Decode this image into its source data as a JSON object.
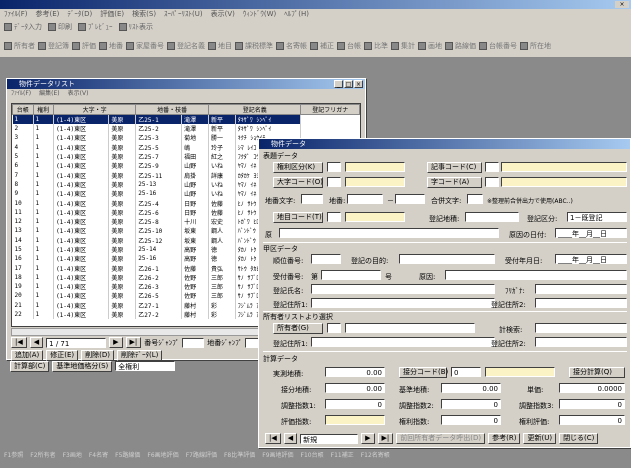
{
  "app": {
    "title": "",
    "menu": [
      "ﾌｧｲﾙ(F)",
      "参考(E)",
      "ﾃﾞｰﾀ(D)",
      "評価(E)",
      "検索(S)",
      "ｽｰﾊﾟｰﾘｽﾄ(U)",
      "表示(V)",
      "ｳｨﾝﾄﾞｳ(W)",
      "ﾍﾙﾌﾟ(H)"
    ],
    "toolbar1": [
      "ﾃﾞｰﾀ入力",
      "印刷",
      "ﾌﾟﾚﾋﾞｭｰ",
      "ﾘｽﾄ表示"
    ],
    "toolbar2": [
      "所有者",
      "登記簿",
      "評価",
      "地番",
      "家屋番号",
      "登記名義",
      "地目",
      "課税標準",
      "名寄帳",
      "補正",
      "台帳",
      "比準",
      "集計",
      "画地",
      "路線価",
      "台帳番号",
      "所在地"
    ],
    "statusbar": [
      "F1参照",
      "F2所有者",
      "F3画地",
      "F4名寄",
      "F5路線価",
      "F6画地評価",
      "F7路線評価",
      "F8比準評価",
      "F9画地評価",
      "F10台帳",
      "F11補正",
      "F12名寄帳"
    ]
  },
  "listwin": {
    "title": "物件データリスト",
    "menu": [
      "ﾌｧｲﾙ(F)",
      "編集(E)",
      "表示(V)"
    ],
    "columns": [
      "台帳",
      "権利",
      "大字・字",
      "地番・枝番",
      "登記名義",
      "登記フリガナ"
    ],
    "rows": [
      [
        "1",
        "1",
        "(1-4)東区",
        "美原",
        "乙25-1",
        "滝澤",
        "新平",
        "ﾀｷｻﾞﾜ ｼﾝﾍﾟｲ"
      ],
      [
        "2",
        "1",
        "(1-4)東区",
        "美原",
        "乙25-2",
        "滝澤",
        "新平",
        "ﾀｷｻﾞﾜ ｼﾝﾍﾟｲ"
      ],
      [
        "3",
        "1",
        "(1-4)東区",
        "美原",
        "乙25-3",
        "菊地",
        "勝一",
        "ｷｸﾁ ｼｮｳｲﾁ"
      ],
      [
        "4",
        "1",
        "(1-4)東区",
        "美原",
        "乙25-5",
        "嶋",
        "玲子",
        "ｼﾏ ﾚｲｺ"
      ],
      [
        "5",
        "1",
        "(1-4)東区",
        "美原",
        "乙25-7",
        "福田",
        "紅之",
        "ﾌｸﾀﾞ ｺｳﾉ"
      ],
      [
        "6",
        "1",
        "(1-4)東区",
        "美原",
        "乙25-9",
        "山野",
        "いね",
        "ﾔﾏﾉ ｲﾈ"
      ],
      [
        "7",
        "1",
        "(1-4)東区",
        "美原",
        "乙25-11",
        "肩掛",
        "詳康",
        "ｶﾀｶｹ ﾖｼﾔｽ"
      ],
      [
        "8",
        "1",
        "(1-4)東区",
        "美原",
        "25-13",
        "山野",
        "いね",
        "ﾔﾏﾉ ｲﾈ"
      ],
      [
        "9",
        "1",
        "(1-4)東区",
        "美原",
        "25-16",
        "山野",
        "いね",
        "ﾔﾏﾉ ｲﾈ"
      ],
      [
        "10",
        "1",
        "(1-4)東区",
        "美原",
        "乙25-4",
        "日野",
        "佐藤",
        "ﾋﾉ ｻﾄｳ"
      ],
      [
        "11",
        "1",
        "(1-4)東区",
        "美原",
        "乙25-6",
        "日野",
        "佐藤",
        "ﾋﾉ ｻﾄｳ"
      ],
      [
        "12",
        "1",
        "(1-4)東区",
        "美原",
        "乙25-8",
        "十川",
        "宏史",
        "ﾄｶﾞﾜ ﾋﾛｼ"
      ],
      [
        "13",
        "1",
        "(1-4)東区",
        "美原",
        "乙25-10",
        "坂東",
        "鋼人",
        "ﾊﾞﾝﾄﾞｳ ｺｳｼﾞﾝ"
      ],
      [
        "14",
        "1",
        "(1-4)東区",
        "美原",
        "乙25-12",
        "坂東",
        "鋼人",
        "ﾊﾞﾝﾄﾞｳ ｺｳｼﾞﾝ"
      ],
      [
        "15",
        "1",
        "(1-4)東区",
        "美原",
        "25-14",
        "高野",
        "徳",
        "ﾀｶﾉ ﾄｸ"
      ],
      [
        "16",
        "1",
        "(1-4)東区",
        "美原",
        "25-16",
        "高野",
        "徳",
        "ﾀｶﾉ ﾄｸ"
      ],
      [
        "17",
        "1",
        "(1-4)東区",
        "美原",
        "乙26-1",
        "佐藤",
        "貴弘",
        "ｻﾄｳ ﾀｶﾋﾛ"
      ],
      [
        "18",
        "1",
        "(1-4)東区",
        "美原",
        "乙26-2",
        "佐野",
        "三郎",
        "ｻﾉ ｻﾌﾞﾛｳ"
      ],
      [
        "19",
        "1",
        "(1-4)東区",
        "美原",
        "乙26-3",
        "佐野",
        "三郎",
        "ｻﾉ ｻﾌﾞﾛｳ"
      ],
      [
        "20",
        "1",
        "(1-4)東区",
        "美原",
        "乙26-5",
        "佐野",
        "三郎",
        "ｻﾉ ｻﾌﾞﾛｳ"
      ],
      [
        "21",
        "1",
        "(1-4)東区",
        "美原",
        "乙27-1",
        "藤村",
        "彩",
        "ﾌｼﾞﾑﾗ ｱﾔ"
      ],
      [
        "22",
        "1",
        "(1-4)東区",
        "美原",
        "乙27-2",
        "藤村",
        "彩",
        "ﾌｼﾞﾑﾗ ｱﾔ"
      ]
    ],
    "record": "1 / 71",
    "jump1_label": "番号ｼﾞｬﾝﾌﾟ",
    "jump2_label": "地番ｼﾞｬﾝﾌﾟ",
    "buttons": [
      "追加(A)",
      "修正(E)",
      "削除(D)",
      "削除ﾃﾞｰﾀ(L)"
    ],
    "calc_button": "計算部(C)",
    "std_button": "基準地価格分(S)",
    "filter_value": "全権利"
  },
  "formwin": {
    "title": "物件データ",
    "sec_table": "表題データ",
    "btn_kenri": "権利区分(K)",
    "btn_kiji": "記事コード(C)",
    "btn_oaza": "大字コード(O)",
    "btn_aza": "字コード(A)",
    "lbl_chiban": "地番文字:",
    "lbl_chiban2": "地番:",
    "lbl_gappei": "合併文字:",
    "gappei_note": "※整理前合併出力で使用(ABC..)",
    "btn_chimoku": "地目コード(T)",
    "lbl_toki_chimoku": "登記地積:",
    "lbl_toki_kubun": "登記区分:",
    "toki_kubun_value": "1－既登記",
    "lbl_gen": "原",
    "lbl_genin": "原因の日付:",
    "date_blank": "____年__月__日",
    "sec_kou": "甲区データ",
    "lbl_juni": "順位番号:",
    "lbl_mokuteki": "登記の目的:",
    "lbl_uketsuke_date": "受付年月日:",
    "lbl_uketsuke_no": "受付番号:",
    "lbl_dai": "第",
    "lbl_go": "号",
    "lbl_gen2": "原因:",
    "lbl_toki_name": "登記氏名:",
    "lbl_furigana": "ﾌﾘｶﾞﾅ:",
    "lbl_jusho1": "登記住所1:",
    "lbl_jusho2": "登記住所2:",
    "sec_owner": "所有者リストより選択",
    "btn_owner": "所有者(G)",
    "lbl_keisu": "計検索:",
    "sec_calc": "計算データ",
    "lbl_jissoku": "実測地積:",
    "jissoku_value": "0.00",
    "btn_sessho": "接分コード(B)",
    "sessho_value": "0",
    "btn_keisan": "接分計算(Q)",
    "lbl_sessho_chiseki": "接分地積:",
    "sessho_chiseki_value": "0.00",
    "lbl_kijun": "基準地積:",
    "kijun_value": "0.00",
    "lbl_tanka": "単価:",
    "tanka_value": "0.0000",
    "lbl_chosei1": "調整指数1:",
    "chosei1_value": "0",
    "lbl_chosei2": "調整指数2:",
    "chosei2_value": "0",
    "lbl_chosei3": "調整指数3:",
    "chosei3_value": "0",
    "lbl_hyoka": "評価指数:",
    "lbl_kenri_shisu": "権利指数:",
    "kenri_shisu_value": "0",
    "lbl_kenri_hyoka": "権利評価:",
    "kenri_hyoka_value": "0",
    "nav_value": "新規",
    "btn_prev": "前回所有者データ呼出(D)",
    "btn_ref": "参考(R)",
    "btn_update": "更新(U)",
    "btn_close": "閉じる(C)"
  }
}
